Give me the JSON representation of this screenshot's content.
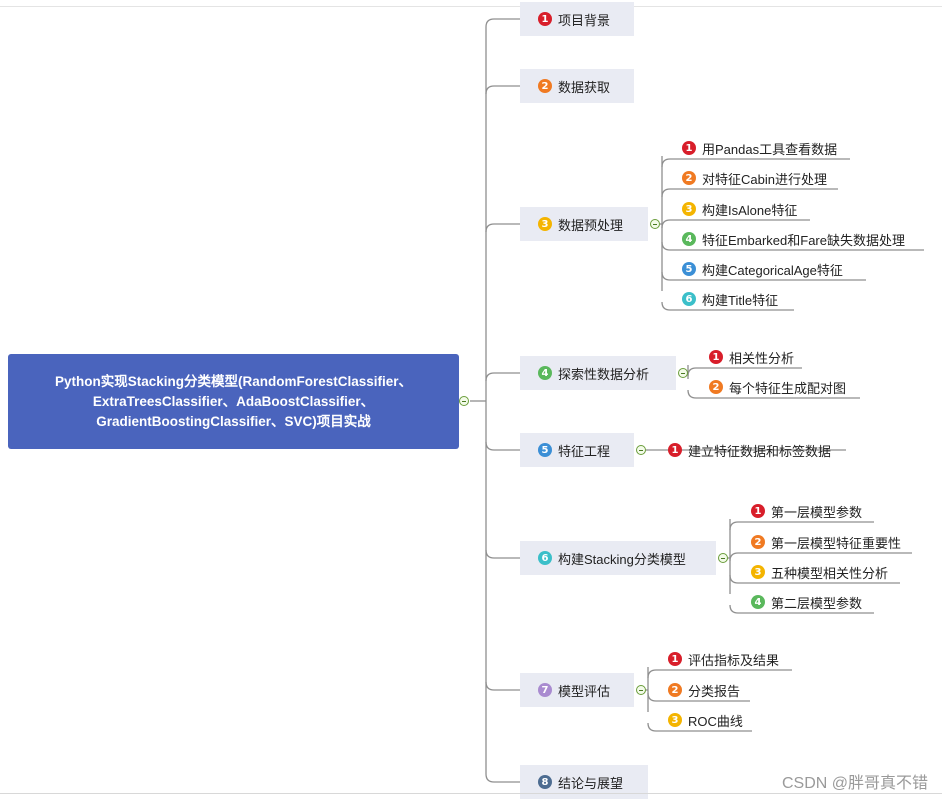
{
  "root": {
    "lines": [
      "Python实现Stacking分类模型(RandomForestClassifier、",
      "ExtraTreesClassifier、AdaBoostClassifier、",
      "GradientBoostingClassifier、SVC)项目实战"
    ]
  },
  "branches": [
    {
      "num": "1",
      "label": "项目背景",
      "color": "#d81e2a",
      "children": []
    },
    {
      "num": "2",
      "label": "数据获取",
      "color": "#f07a22",
      "children": []
    },
    {
      "num": "3",
      "label": "数据预处理",
      "color": "#f4b400",
      "children": [
        {
          "num": "1",
          "label": "用Pandas工具查看数据",
          "color": "#d81e2a"
        },
        {
          "num": "2",
          "label": "对特征Cabin进行处理",
          "color": "#f07a22"
        },
        {
          "num": "3",
          "label": "构建IsAlone特征",
          "color": "#f4b400"
        },
        {
          "num": "4",
          "label": "特征Embarked和Fare缺失数据处理",
          "color": "#5ab85c"
        },
        {
          "num": "5",
          "label": "构建CategoricalAge特征",
          "color": "#3b8fd6"
        },
        {
          "num": "6",
          "label": "构建Title特征",
          "color": "#3bbfc9"
        }
      ]
    },
    {
      "num": "4",
      "label": "探索性数据分析",
      "color": "#5ab85c",
      "children": [
        {
          "num": "1",
          "label": "相关性分析",
          "color": "#d81e2a"
        },
        {
          "num": "2",
          "label": "每个特征生成配对图",
          "color": "#f07a22"
        }
      ]
    },
    {
      "num": "5",
      "label": "特征工程",
      "color": "#3b8fd6",
      "children": [
        {
          "num": "1",
          "label": "建立特征数据和标签数据",
          "color": "#d81e2a"
        }
      ]
    },
    {
      "num": "6",
      "label": "构建Stacking分类模型",
      "color": "#3bbfc9",
      "children": [
        {
          "num": "1",
          "label": "第一层模型参数",
          "color": "#d81e2a"
        },
        {
          "num": "2",
          "label": "第一层模型特征重要性",
          "color": "#f07a22"
        },
        {
          "num": "3",
          "label": "五种模型相关性分析",
          "color": "#f4b400"
        },
        {
          "num": "4",
          "label": "第二层模型参数",
          "color": "#5ab85c"
        }
      ]
    },
    {
      "num": "7",
      "label": "模型评估",
      "color": "#a98bd0",
      "children": [
        {
          "num": "1",
          "label": "评估指标及结果",
          "color": "#d81e2a"
        },
        {
          "num": "2",
          "label": "分类报告",
          "color": "#f07a22"
        },
        {
          "num": "3",
          "label": "ROC曲线",
          "color": "#f4b400"
        }
      ]
    },
    {
      "num": "8",
      "label": "结论与展望",
      "color": "#4d6c91",
      "children": []
    }
  ],
  "watermark": "CSDN @胖哥真不错",
  "colors": {
    "root_bg": "#4a64bd",
    "node_bg": "#e9ebf3",
    "connector": "#8f8f8f",
    "toggle": "#6a9d3b"
  }
}
